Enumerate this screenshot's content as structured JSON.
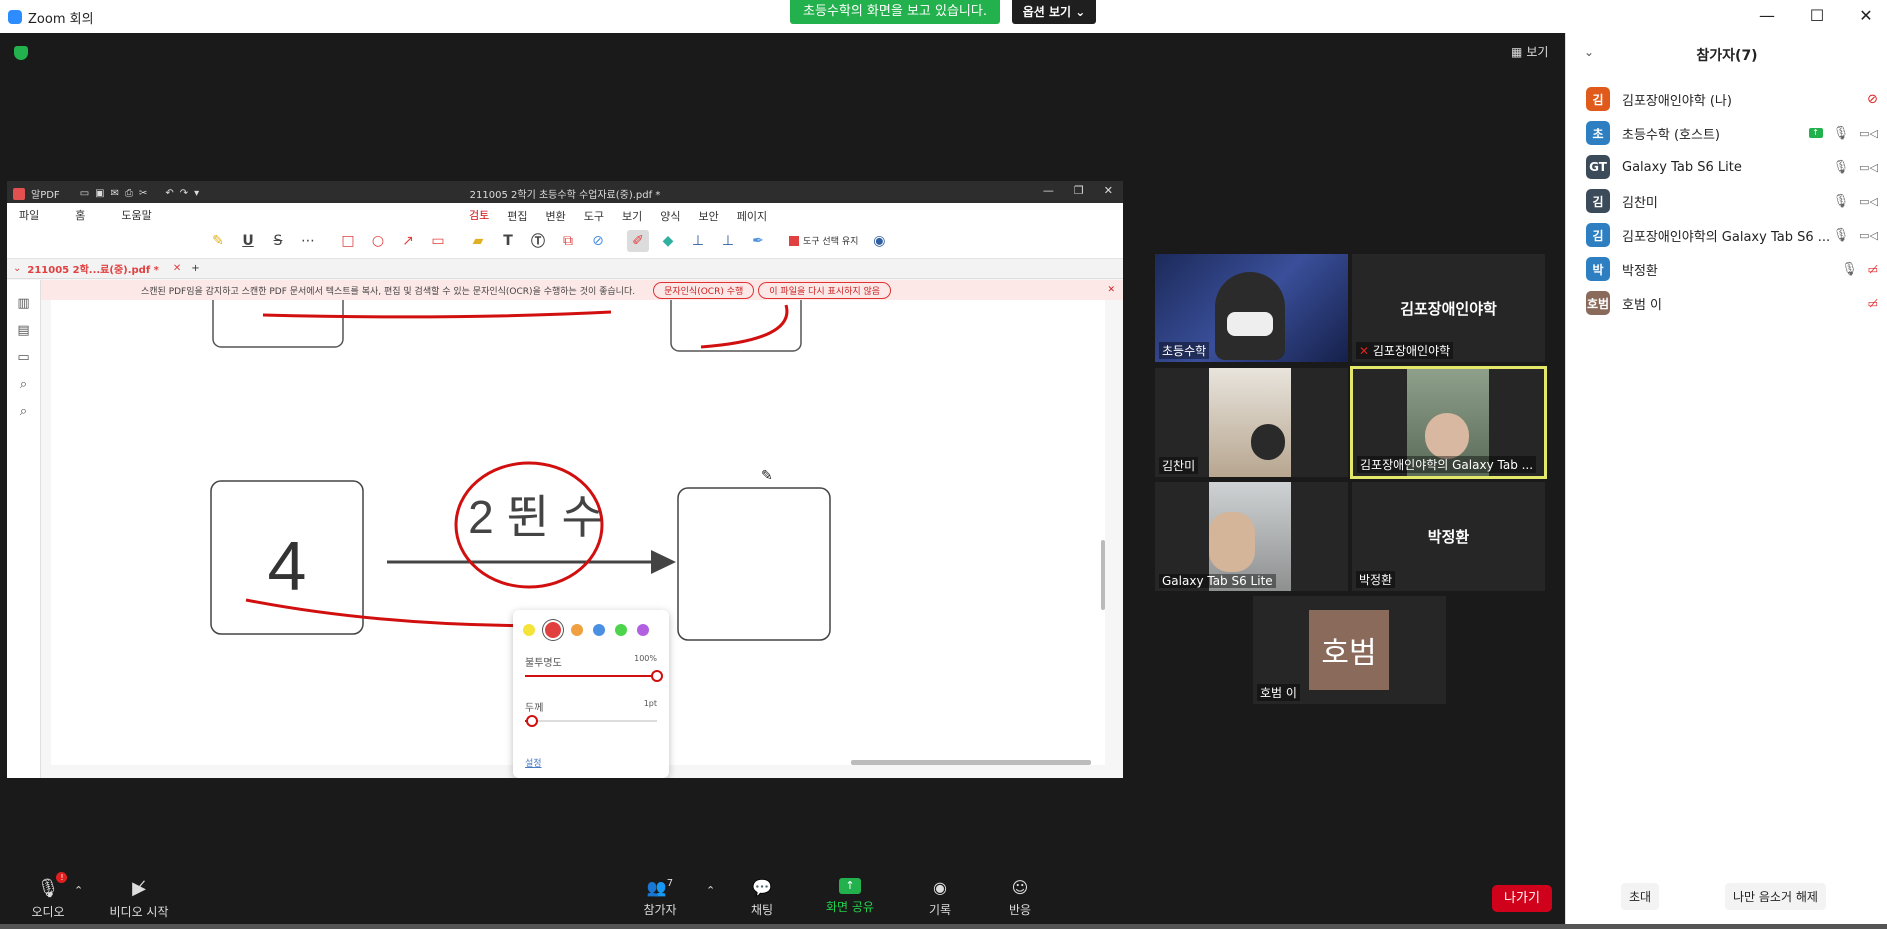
{
  "window": {
    "title": "Zoom 회의",
    "share_banner": "초등수학의 화면을 보고 있습니다.",
    "view_options": "옵션 보기"
  },
  "stage": {
    "view_label": "보기"
  },
  "pdf": {
    "app_name": "알PDF",
    "doc_title": "211005 2학기 초등수학 수업자료(중).pdf *",
    "menus": [
      "파일",
      "홈",
      "도움말"
    ],
    "ribbon_tabs": [
      "검토",
      "편집",
      "변환",
      "도구",
      "보기",
      "양식",
      "보안",
      "페이지"
    ],
    "active_ribbon_tab": "검토",
    "keep_tool_label": "도구 선택 유지",
    "tab_label": "211005 2학...료(중).pdf *",
    "notice": "스캔된 PDF임을 감지하고 스캔한 PDF 문서에서 텍스트를 복사, 편집 및 검색할 수 있는 문자인식(OCR)을 수행하는 것이 좋습니다.",
    "ocr_button": "문자인식(OCR) 수행",
    "dismiss_button": "이 파일을 다시 표시하지 않음",
    "content": {
      "number": "4",
      "rule": "2 뛴 수"
    },
    "pen_popup": {
      "colors": [
        "#f5e33a",
        "#e04040",
        "#f0a040",
        "#4a90e2",
        "#4cd44c",
        "#b060e0"
      ],
      "selected_color": "#e04040",
      "opacity_label": "불투명도",
      "opacity_value": "100%",
      "opacity_level": 1.0,
      "thickness_label": "두께",
      "thickness_value": "1pt",
      "thickness_level": 0.05,
      "settings_link": "설정"
    }
  },
  "controls": {
    "audio": "오디오",
    "video": "비디오 시작",
    "participants": "참가자",
    "participants_count": "7",
    "chat": "채팅",
    "share": "화면 공유",
    "record": "기록",
    "reactions": "반응",
    "leave": "나가기"
  },
  "tiles": [
    {
      "name": "초등수학",
      "type": "video"
    },
    {
      "name": "김포장애인야학",
      "type": "name",
      "muted": true
    },
    {
      "name": "김찬미",
      "type": "video"
    },
    {
      "name": "김포장애인야학의 Galaxy Tab ...",
      "type": "video",
      "active": true
    },
    {
      "name": "Galaxy Tab S6 Lite",
      "type": "video"
    },
    {
      "name": "박정환",
      "type": "name"
    },
    {
      "name": "호범 이",
      "type": "avatar",
      "avatar_text": "호범"
    }
  ],
  "panel": {
    "title": "참가자(7)",
    "participants": [
      {
        "initial": "김",
        "color": "#e05a1c",
        "name": "김포장애인야학 (나)",
        "mic": "muted-red",
        "video": "none"
      },
      {
        "initial": "초",
        "color": "#2d7fc1",
        "name": "초등수학 (호스트)",
        "share": true,
        "mic": "on",
        "video": "on"
      },
      {
        "initial": "GT",
        "color": "#3c4b5a",
        "name": "Galaxy Tab S6 Lite",
        "mic": "on",
        "video": "on"
      },
      {
        "initial": "김",
        "color": "#3c4b5a",
        "name": "김찬미",
        "mic": "on",
        "video": "on"
      },
      {
        "initial": "김",
        "color": "#2d7fc1",
        "name": "김포장애인야학의 Galaxy Tab S6 ...",
        "mic": "on",
        "video": "on"
      },
      {
        "initial": "박",
        "color": "#2d7fc1",
        "name": "박정환",
        "mic": "on",
        "video": "off-red"
      },
      {
        "initial": "호범",
        "color": "#8a6a5a",
        "name": "호범 이",
        "mic": "none",
        "video": "off-red"
      }
    ],
    "invite": "초대",
    "unmute_me": "나만 음소거 해제"
  }
}
